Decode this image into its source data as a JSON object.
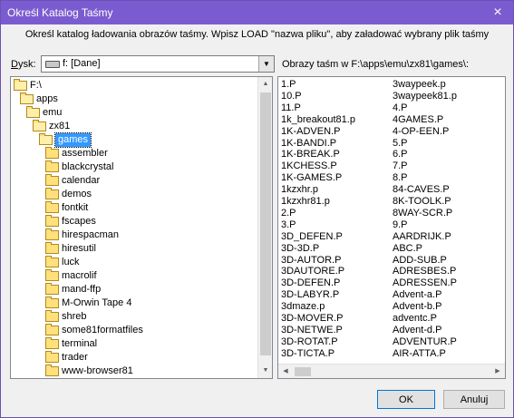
{
  "window": {
    "title": "Określ Katalog Taśmy"
  },
  "instructions": "Określ katalog ładowania obrazów taśmy. Wpisz LOAD \"nazwa pliku\", aby załadować wybrany plik taśmy",
  "drive": {
    "label_prefix": "D",
    "label_rest": "ysk:",
    "value": "f: [Dane]"
  },
  "right_header": "Obrazy taśm w F:\\apps\\emu\\zx81\\games\\:",
  "tree": [
    {
      "label": "F:\\",
      "icon": "open-folder-icon",
      "level": 0
    },
    {
      "label": "apps",
      "icon": "open-folder-icon",
      "level": 1
    },
    {
      "label": "emu",
      "icon": "open-folder-icon",
      "level": 2
    },
    {
      "label": "zx81",
      "icon": "open-folder-icon",
      "level": 3
    },
    {
      "label": "games",
      "icon": "open-folder-icon",
      "level": 4,
      "selected": true
    },
    {
      "label": "assembler",
      "icon": "folder-icon",
      "level": 5
    },
    {
      "label": "blackcrystal",
      "icon": "folder-icon",
      "level": 5
    },
    {
      "label": "calendar",
      "icon": "folder-icon",
      "level": 5
    },
    {
      "label": "demos",
      "icon": "folder-icon",
      "level": 5
    },
    {
      "label": "fontkit",
      "icon": "folder-icon",
      "level": 5
    },
    {
      "label": "fscapes",
      "icon": "folder-icon",
      "level": 5
    },
    {
      "label": "hirespacman",
      "icon": "folder-icon",
      "level": 5
    },
    {
      "label": "hiresutil",
      "icon": "folder-icon",
      "level": 5
    },
    {
      "label": "luck",
      "icon": "folder-icon",
      "level": 5
    },
    {
      "label": "macrolif",
      "icon": "folder-icon",
      "level": 5
    },
    {
      "label": "mand-ffp",
      "icon": "folder-icon",
      "level": 5
    },
    {
      "label": "M-Orwin Tape 4",
      "icon": "folder-icon",
      "level": 5
    },
    {
      "label": "shreb",
      "icon": "folder-icon",
      "level": 5
    },
    {
      "label": "some81formatfiles",
      "icon": "folder-icon",
      "level": 5
    },
    {
      "label": "terminal",
      "icon": "folder-icon",
      "level": 5
    },
    {
      "label": "trader",
      "icon": "folder-icon",
      "level": 5
    },
    {
      "label": "www-browser81",
      "icon": "folder-icon",
      "level": 5
    }
  ],
  "files_col1": [
    "1.P",
    "10.P",
    "11.P",
    "1k_breakout81.p",
    "1K-ADVEN.P",
    "1K-BANDI.P",
    "1K-BREAK.P",
    "1KCHESS.P",
    "1K-GAMES.P",
    "1kzxhr.p",
    "1kzxhr81.p",
    "2.P",
    "3.P",
    "3D_DEFEN.P",
    "3D-3D.P",
    "3D-AUTOR.P",
    "3DAUTORE.P",
    "3D-DEFEN.P",
    "3D-LABYR.P",
    "3dmaze.p",
    "3D-MOVER.P",
    "3D-NETWE.P",
    "3D-ROTAT.P",
    "3D-TICTA.P"
  ],
  "files_col2": [
    "3waypeek.p",
    "3waypeek81.p",
    "4.P",
    "4GAMES.P",
    "4-OP-EEN.P",
    "5.P",
    "6.P",
    "7.P",
    "8.P",
    "84-CAVES.P",
    "8K-TOOLK.P",
    "8WAY-SCR.P",
    "9.P",
    "AARDRIJK.P",
    "ABC.P",
    "ADD-SUB.P",
    "ADRESBES.P",
    "ADRESSEN.P",
    "Advent-a.P",
    "Advent-b.P",
    "adventc.P",
    "Advent-d.P",
    "ADVENTUR.P",
    "AIR-ATTA.P"
  ],
  "buttons": {
    "ok": "OK",
    "cancel": "Anuluj"
  },
  "icons": {
    "close": "×",
    "dropdown": "▼",
    "up": "▲",
    "down": "▼",
    "left": "◀",
    "right": "▶"
  }
}
